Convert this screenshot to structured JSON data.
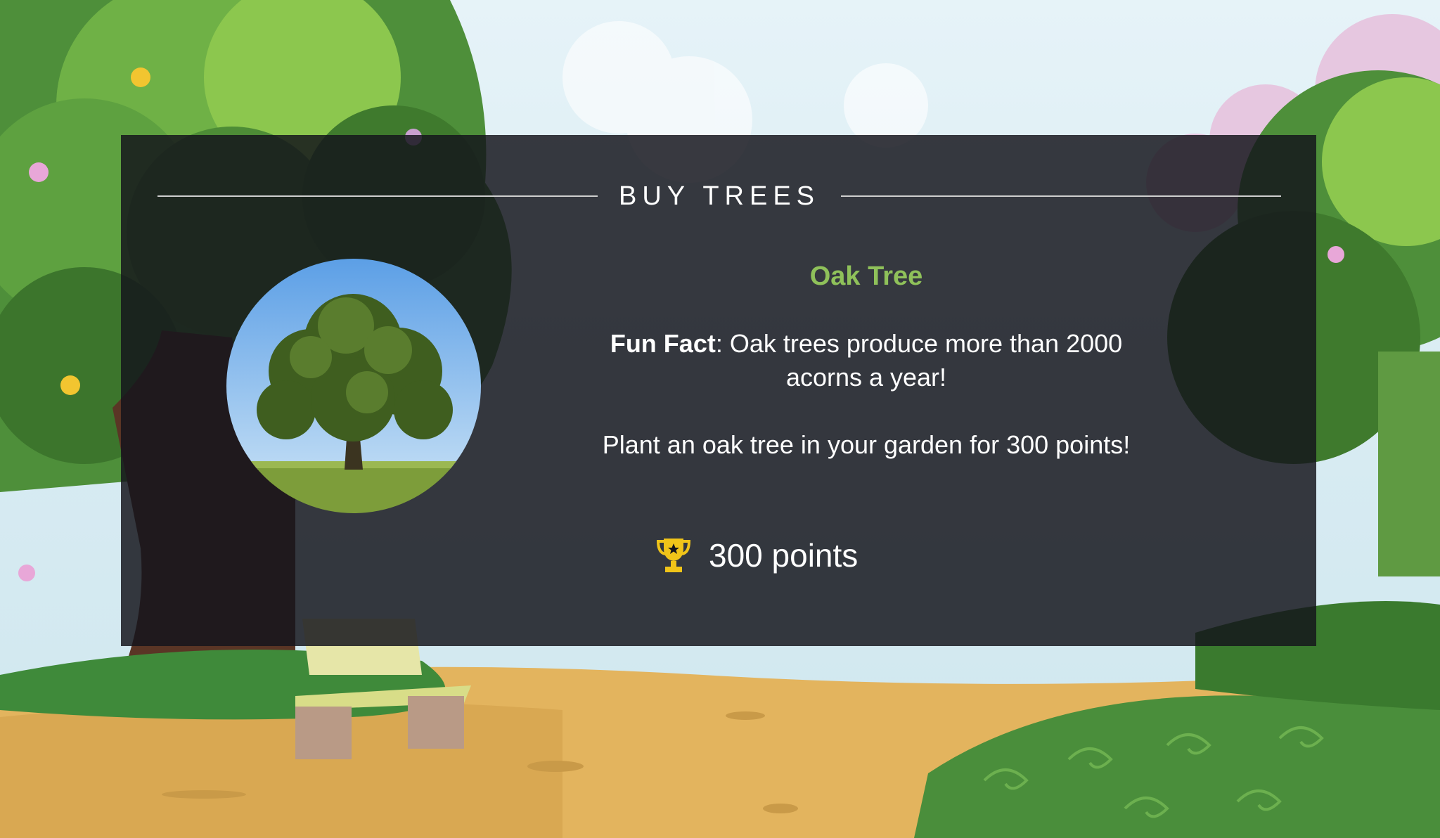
{
  "panel": {
    "title": "BUY TREES"
  },
  "tree": {
    "name": "Oak Tree",
    "fun_fact_label": "Fun Fact",
    "fun_fact_text": ": Oak trees produce more than 2000 acorns a year!",
    "plant_text": "Plant an oak tree in your garden for 300 points!",
    "cost_label": "300 points",
    "cost_icon": "trophy-icon"
  },
  "colors": {
    "tree_name": "#8fc15a",
    "trophy": "#f0c419",
    "panel_bg": "#14141c"
  }
}
